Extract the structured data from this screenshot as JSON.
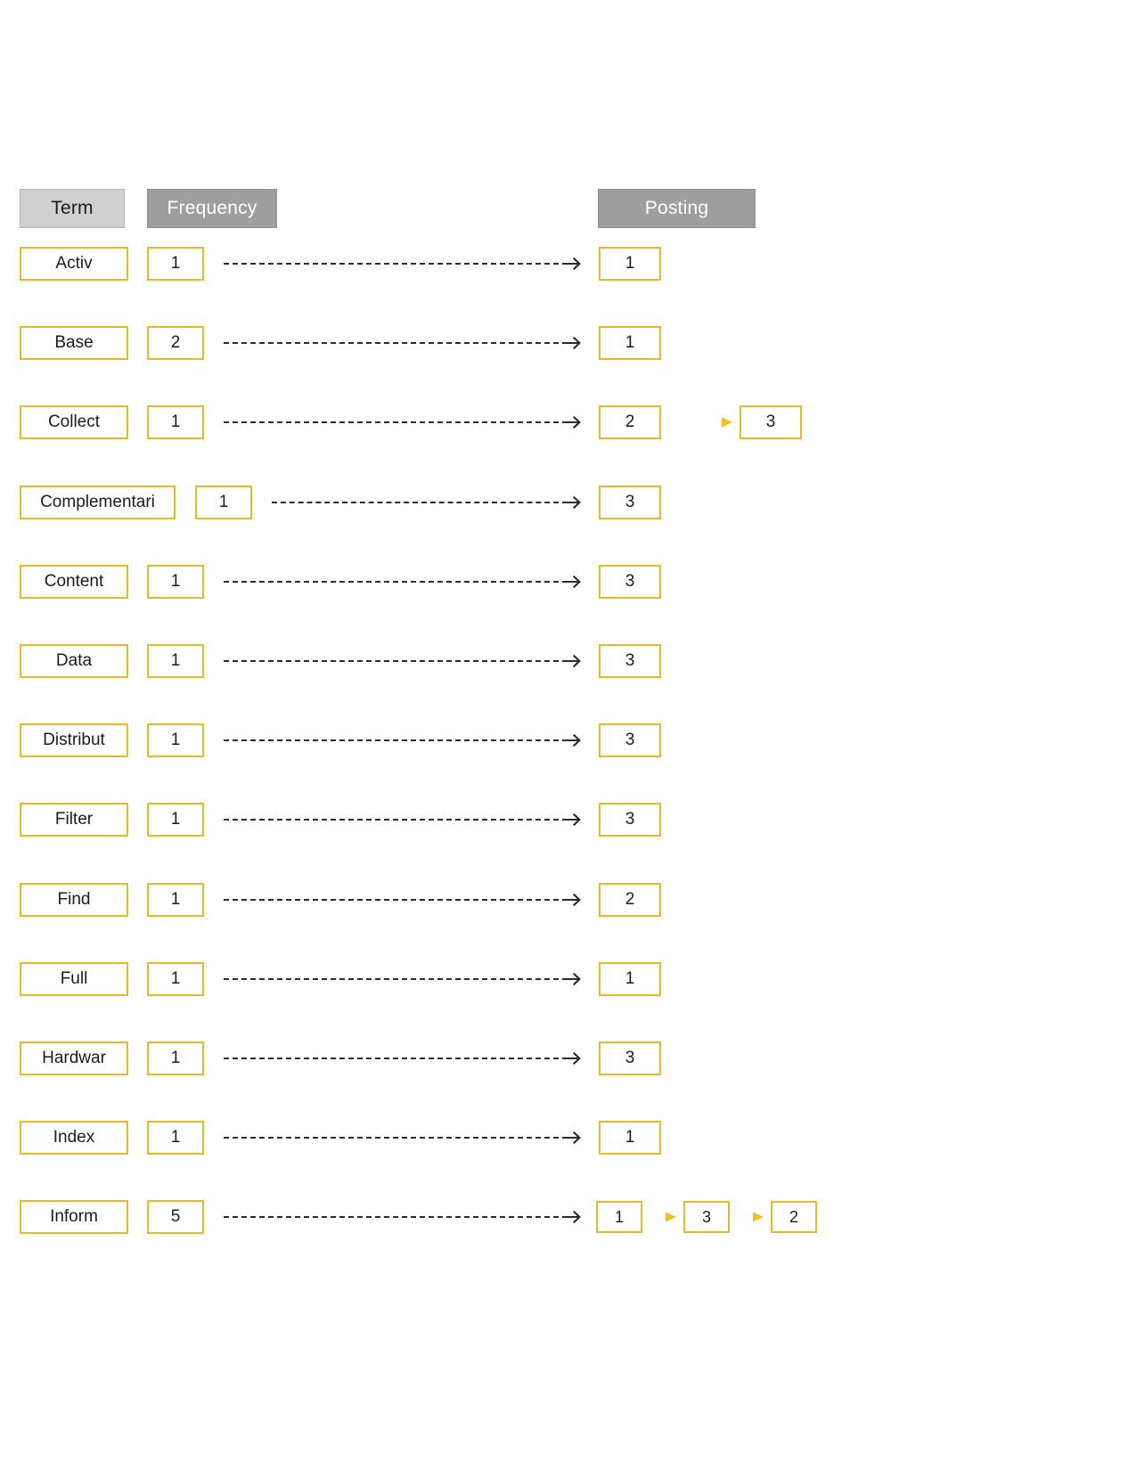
{
  "diagram": {
    "title": "Inverted index term / frequency / posting list",
    "colors": {
      "box_border": "#e8b82a",
      "header_term_bg": "#d0d0d0",
      "header_bg": "#9e9e9e",
      "header_text": "#ffffff",
      "dash_arrow": "#2b2b2b",
      "chain_arrow": "#f2bf1e",
      "text": "#1c1c1c",
      "background": "#ffffff"
    },
    "headers": {
      "term": "Term",
      "frequency": "Frequency",
      "posting": "Posting"
    },
    "rows": [
      {
        "term": "Activ",
        "frequency": "1",
        "postings": [
          "1"
        ]
      },
      {
        "term": "Base",
        "frequency": "2",
        "postings": [
          "1"
        ]
      },
      {
        "term": "Collect",
        "frequency": "1",
        "postings": [
          "2",
          "3"
        ]
      },
      {
        "term": "Complementari",
        "frequency": "1",
        "postings": [
          "3"
        ]
      },
      {
        "term": "Content",
        "frequency": "1",
        "postings": [
          "3"
        ]
      },
      {
        "term": "Data",
        "frequency": "1",
        "postings": [
          "3"
        ]
      },
      {
        "term": "Distribut",
        "frequency": "1",
        "postings": [
          "3"
        ]
      },
      {
        "term": "Filter",
        "frequency": "1",
        "postings": [
          "3"
        ]
      },
      {
        "term": "Find",
        "frequency": "1",
        "postings": [
          "2"
        ]
      },
      {
        "term": "Full",
        "frequency": "1",
        "postings": [
          "1"
        ]
      },
      {
        "term": "Hardwar",
        "frequency": "1",
        "postings": [
          "3"
        ]
      },
      {
        "term": "Index",
        "frequency": "1",
        "postings": [
          "1"
        ]
      },
      {
        "term": "Inform",
        "frequency": "5",
        "postings": [
          "1",
          "3",
          "2"
        ]
      }
    ]
  }
}
